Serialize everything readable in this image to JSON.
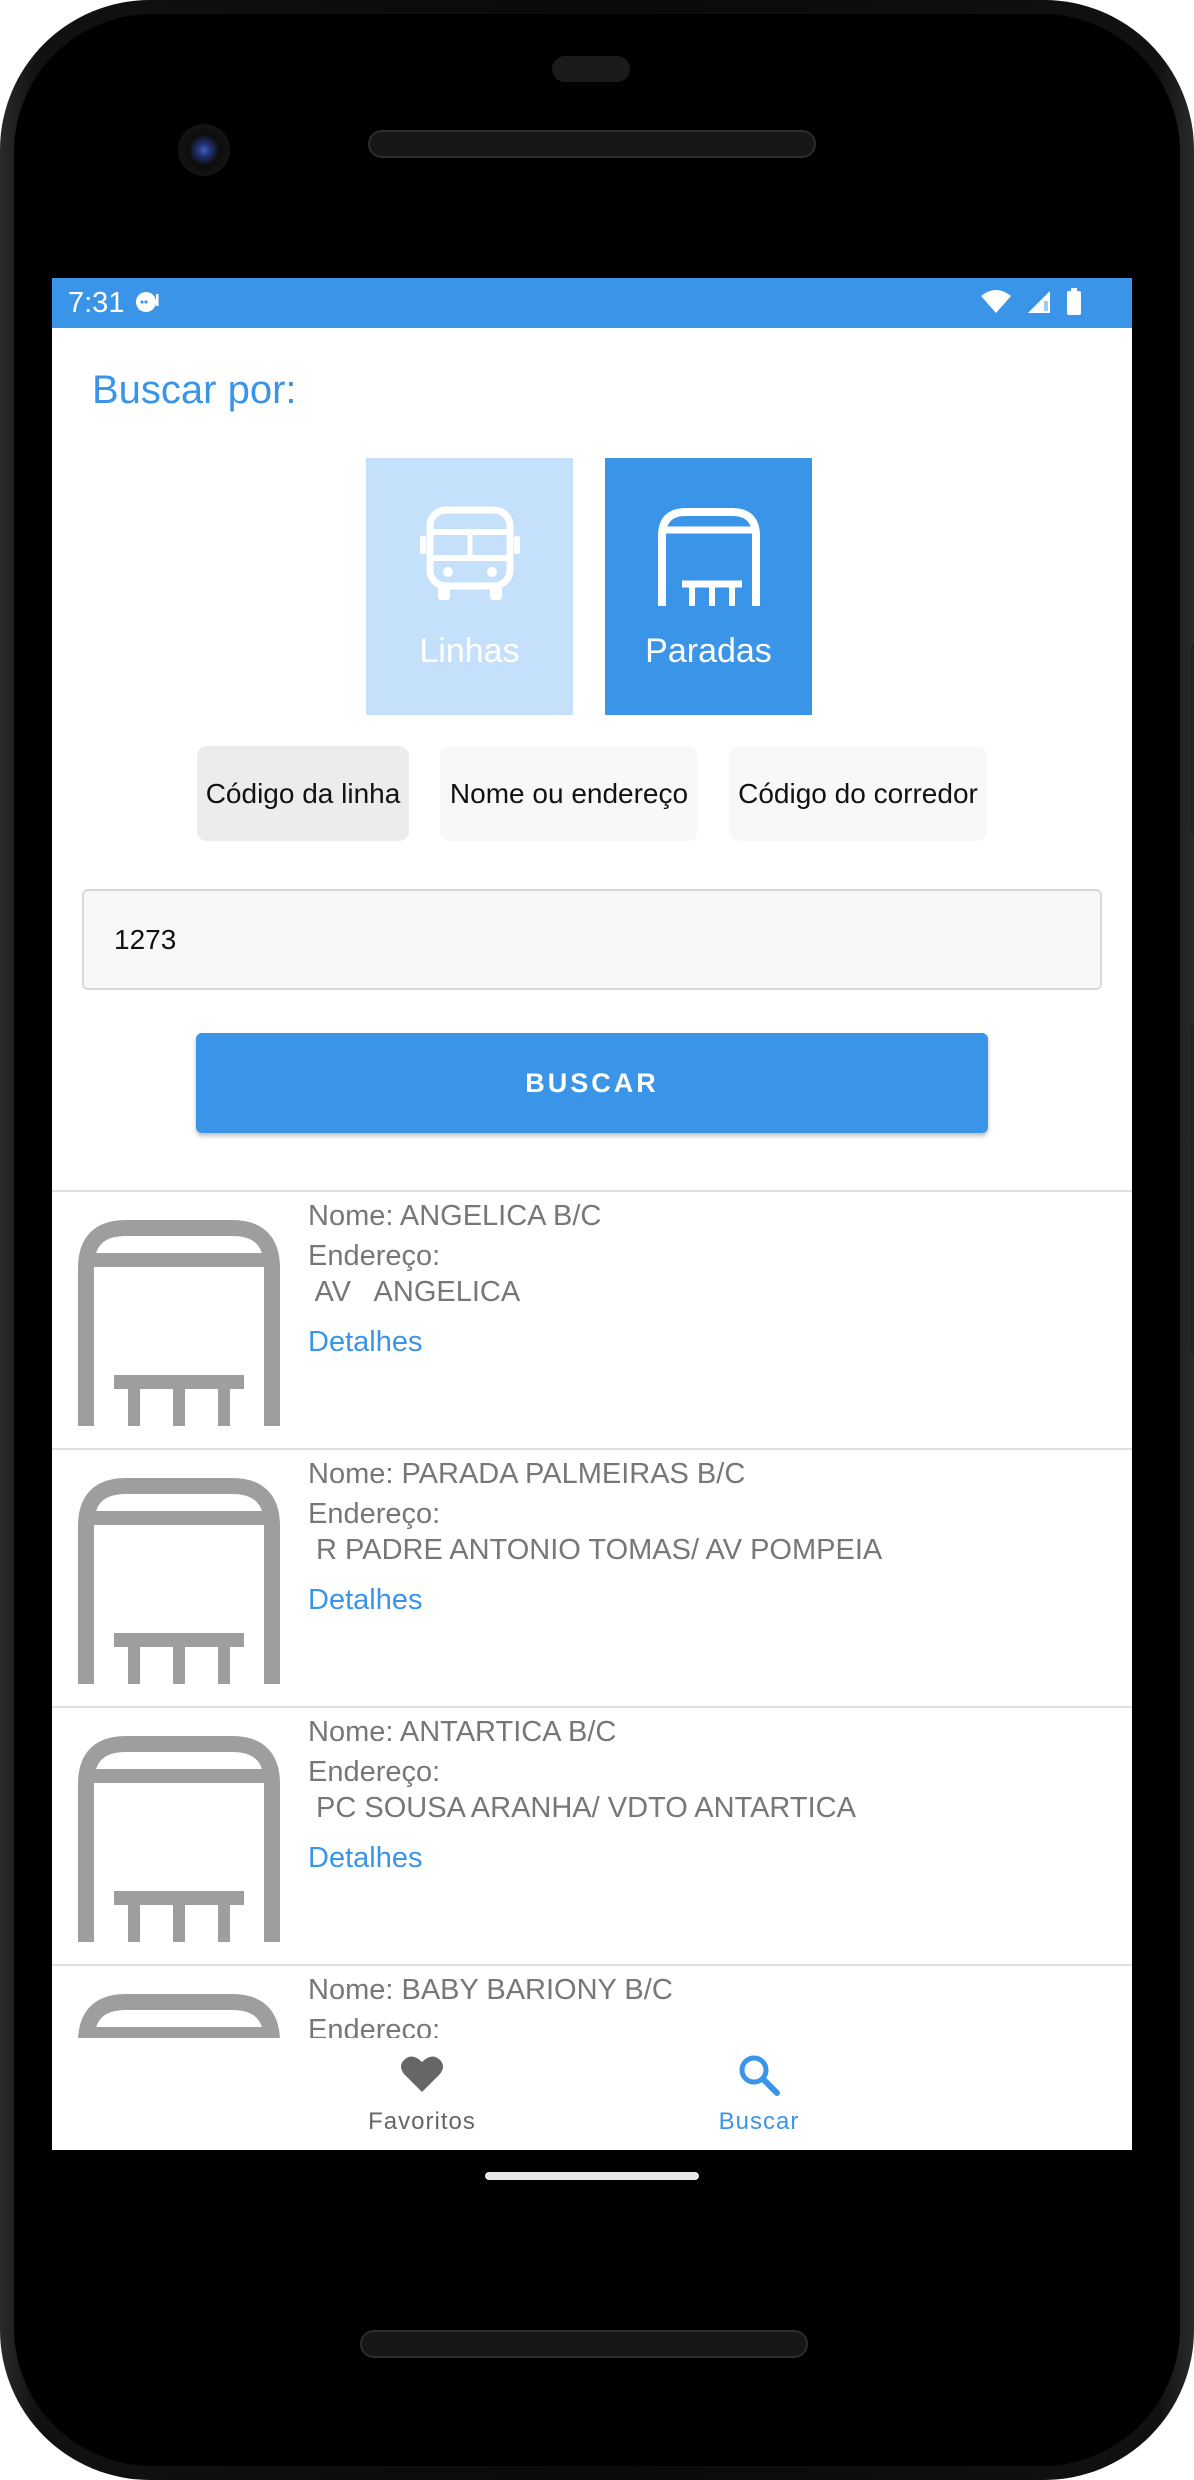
{
  "status_bar": {
    "time": "7:31",
    "color": "#3a95e8"
  },
  "search": {
    "title": "Buscar por:",
    "types": [
      {
        "label": "Linhas",
        "icon": "bus-icon",
        "selected": false
      },
      {
        "label": "Paradas",
        "icon": "bus-stop-icon",
        "selected": true
      }
    ],
    "filters": [
      {
        "label": "Código da linha",
        "selected": true
      },
      {
        "label": "Nome ou endereço",
        "selected": false
      },
      {
        "label": "Código do corredor",
        "selected": false
      }
    ],
    "input_value": "1273",
    "button_label": "BUSCAR"
  },
  "results": [
    {
      "name": "Nome: ANGELICA B/C",
      "address_label": "Endereço:",
      "address": " AV   ANGELICA",
      "link": "Detalhes"
    },
    {
      "name": "Nome: PARADA PALMEIRAS B/C",
      "address_label": "Endereço:",
      "address": " R PADRE ANTONIO TOMAS/ AV POMPEIA",
      "link": "Detalhes"
    },
    {
      "name": "Nome: ANTARTICA B/C",
      "address_label": "Endereço:",
      "address": " PC SOUSA ARANHA/ VDTO ANTARTICA",
      "link": "Detalhes"
    },
    {
      "name": "Nome: BABY BARIONY B/C",
      "address_label": "Endereço:",
      "address": "",
      "link": ""
    }
  ],
  "bottom_nav": [
    {
      "label": "Favoritos",
      "icon": "heart-icon",
      "active": false
    },
    {
      "label": "Buscar",
      "icon": "search-icon",
      "active": true
    }
  ],
  "colors": {
    "accent": "#3a95e8",
    "accent_light": "#c5e0fa",
    "muted_text": "#777777",
    "icon_gray": "#9e9e9e"
  }
}
